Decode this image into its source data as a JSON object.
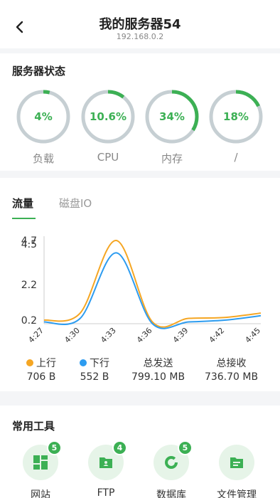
{
  "header": {
    "title": "我的服务器54",
    "subtitle": "192.168.0.2",
    "back_icon": "chevron-left-icon"
  },
  "status": {
    "title": "服务器状态",
    "gauges": [
      {
        "value": "4%",
        "label": "负载",
        "fraction": 0.04
      },
      {
        "value": "10.6%",
        "label": "CPU",
        "fraction": 0.106
      },
      {
        "value": "34%",
        "label": "内存",
        "fraction": 0.34
      },
      {
        "value": "18%",
        "label": "/",
        "fraction": 0.18
      }
    ]
  },
  "traffic": {
    "tabs": [
      {
        "label": "流量",
        "active": true
      },
      {
        "label": "磁盘IO",
        "active": false
      }
    ],
    "legend": [
      {
        "label": "上行",
        "value": "706 B",
        "color": "#f5a623"
      },
      {
        "label": "下行",
        "value": "552 B",
        "color": "#2d9cf0"
      },
      {
        "label": "总发送",
        "value": "799.10 MB"
      },
      {
        "label": "总接收",
        "value": "736.70 MB"
      }
    ]
  },
  "chart_data": {
    "type": "line",
    "x": [
      "4:27",
      "4:30",
      "4:33",
      "4:36",
      "4:39",
      "4:42",
      "4:45"
    ],
    "y_ticks": [
      "0.2",
      "2.2",
      "4.5",
      "4.7"
    ],
    "series": [
      {
        "name": "上行",
        "color": "#f5a623",
        "values": [
          0.2,
          0.6,
          4.7,
          0.1,
          0.3,
          0.35,
          0.6
        ]
      },
      {
        "name": "下行",
        "color": "#2d9cf0",
        "values": [
          0.1,
          0.3,
          4.0,
          0.0,
          0.1,
          0.2,
          0.45
        ]
      }
    ],
    "ylim": [
      0,
      4.7
    ]
  },
  "tools": {
    "title": "常用工具",
    "items": [
      {
        "label": "网站",
        "badge": "5",
        "icon": "website-grid-icon"
      },
      {
        "label": "FTP",
        "badge": "4",
        "icon": "ftp-folder-icon"
      },
      {
        "label": "数据库",
        "badge": "5",
        "icon": "database-ring-icon"
      },
      {
        "label": "文件管理",
        "badge": "",
        "icon": "file-manager-icon"
      }
    ]
  }
}
